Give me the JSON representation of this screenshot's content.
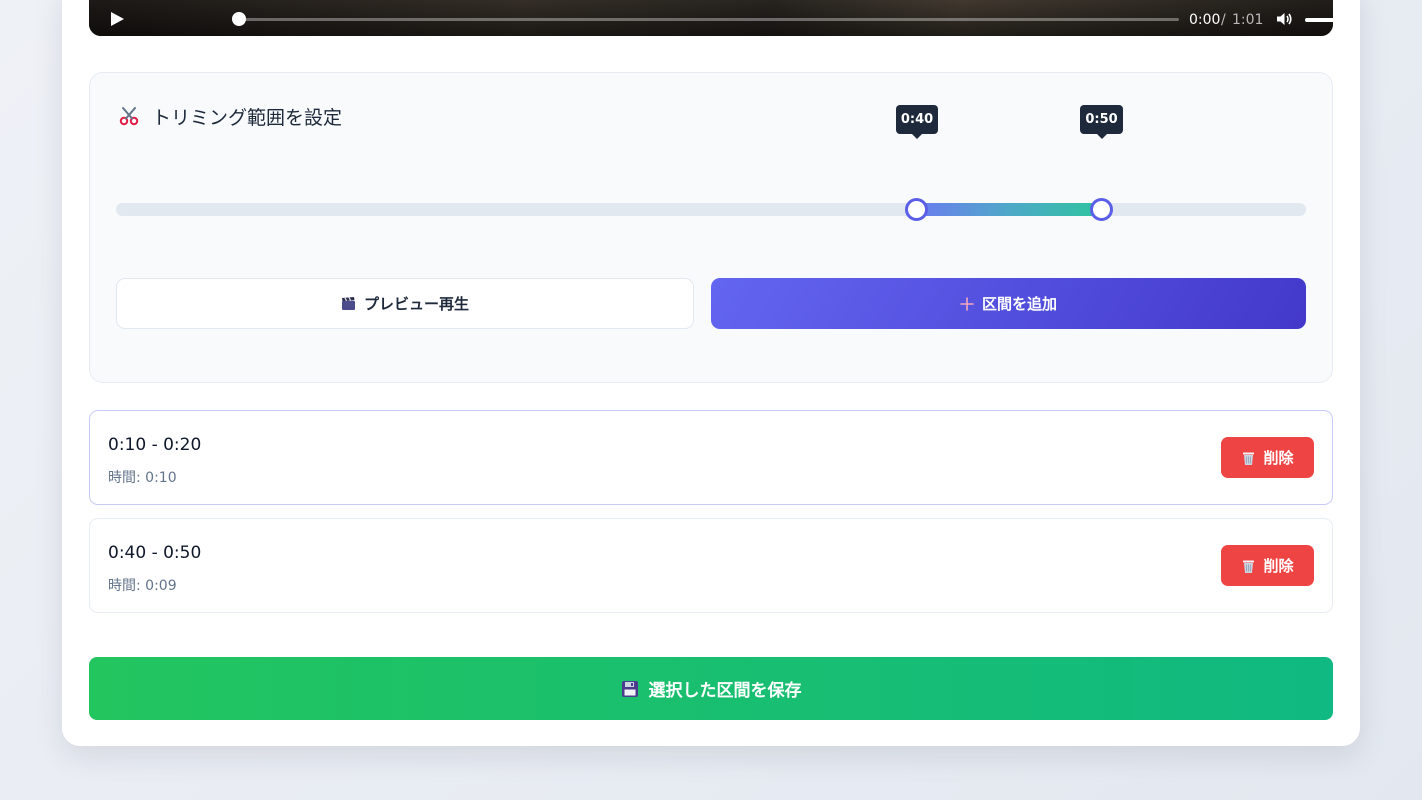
{
  "player": {
    "time_current": "0:00",
    "time_separator": "/",
    "time_total": "1:01",
    "icons": [
      "play-icon",
      "volume-icon",
      "fullscreen-icon"
    ]
  },
  "trim": {
    "title": "トリミング範囲を設定",
    "start_label": "0:40",
    "end_label": "0:50",
    "preview_label": "プレビュー再生",
    "add_label": "区間を追加",
    "accent": "#6366f1"
  },
  "segments": [
    {
      "range": "0:10 - 0:20",
      "duration": "時間: 0:10",
      "delete_label": "削除"
    },
    {
      "range": "0:40 - 0:50",
      "duration": "時間: 0:09",
      "delete_label": "削除"
    }
  ],
  "save": {
    "label": "選択した区間を保存"
  },
  "colors": {
    "delete": "#ef4444",
    "save_start": "#22c55e",
    "save_end": "#10b981",
    "add_start": "#6366f1",
    "add_end": "#4338ca"
  }
}
